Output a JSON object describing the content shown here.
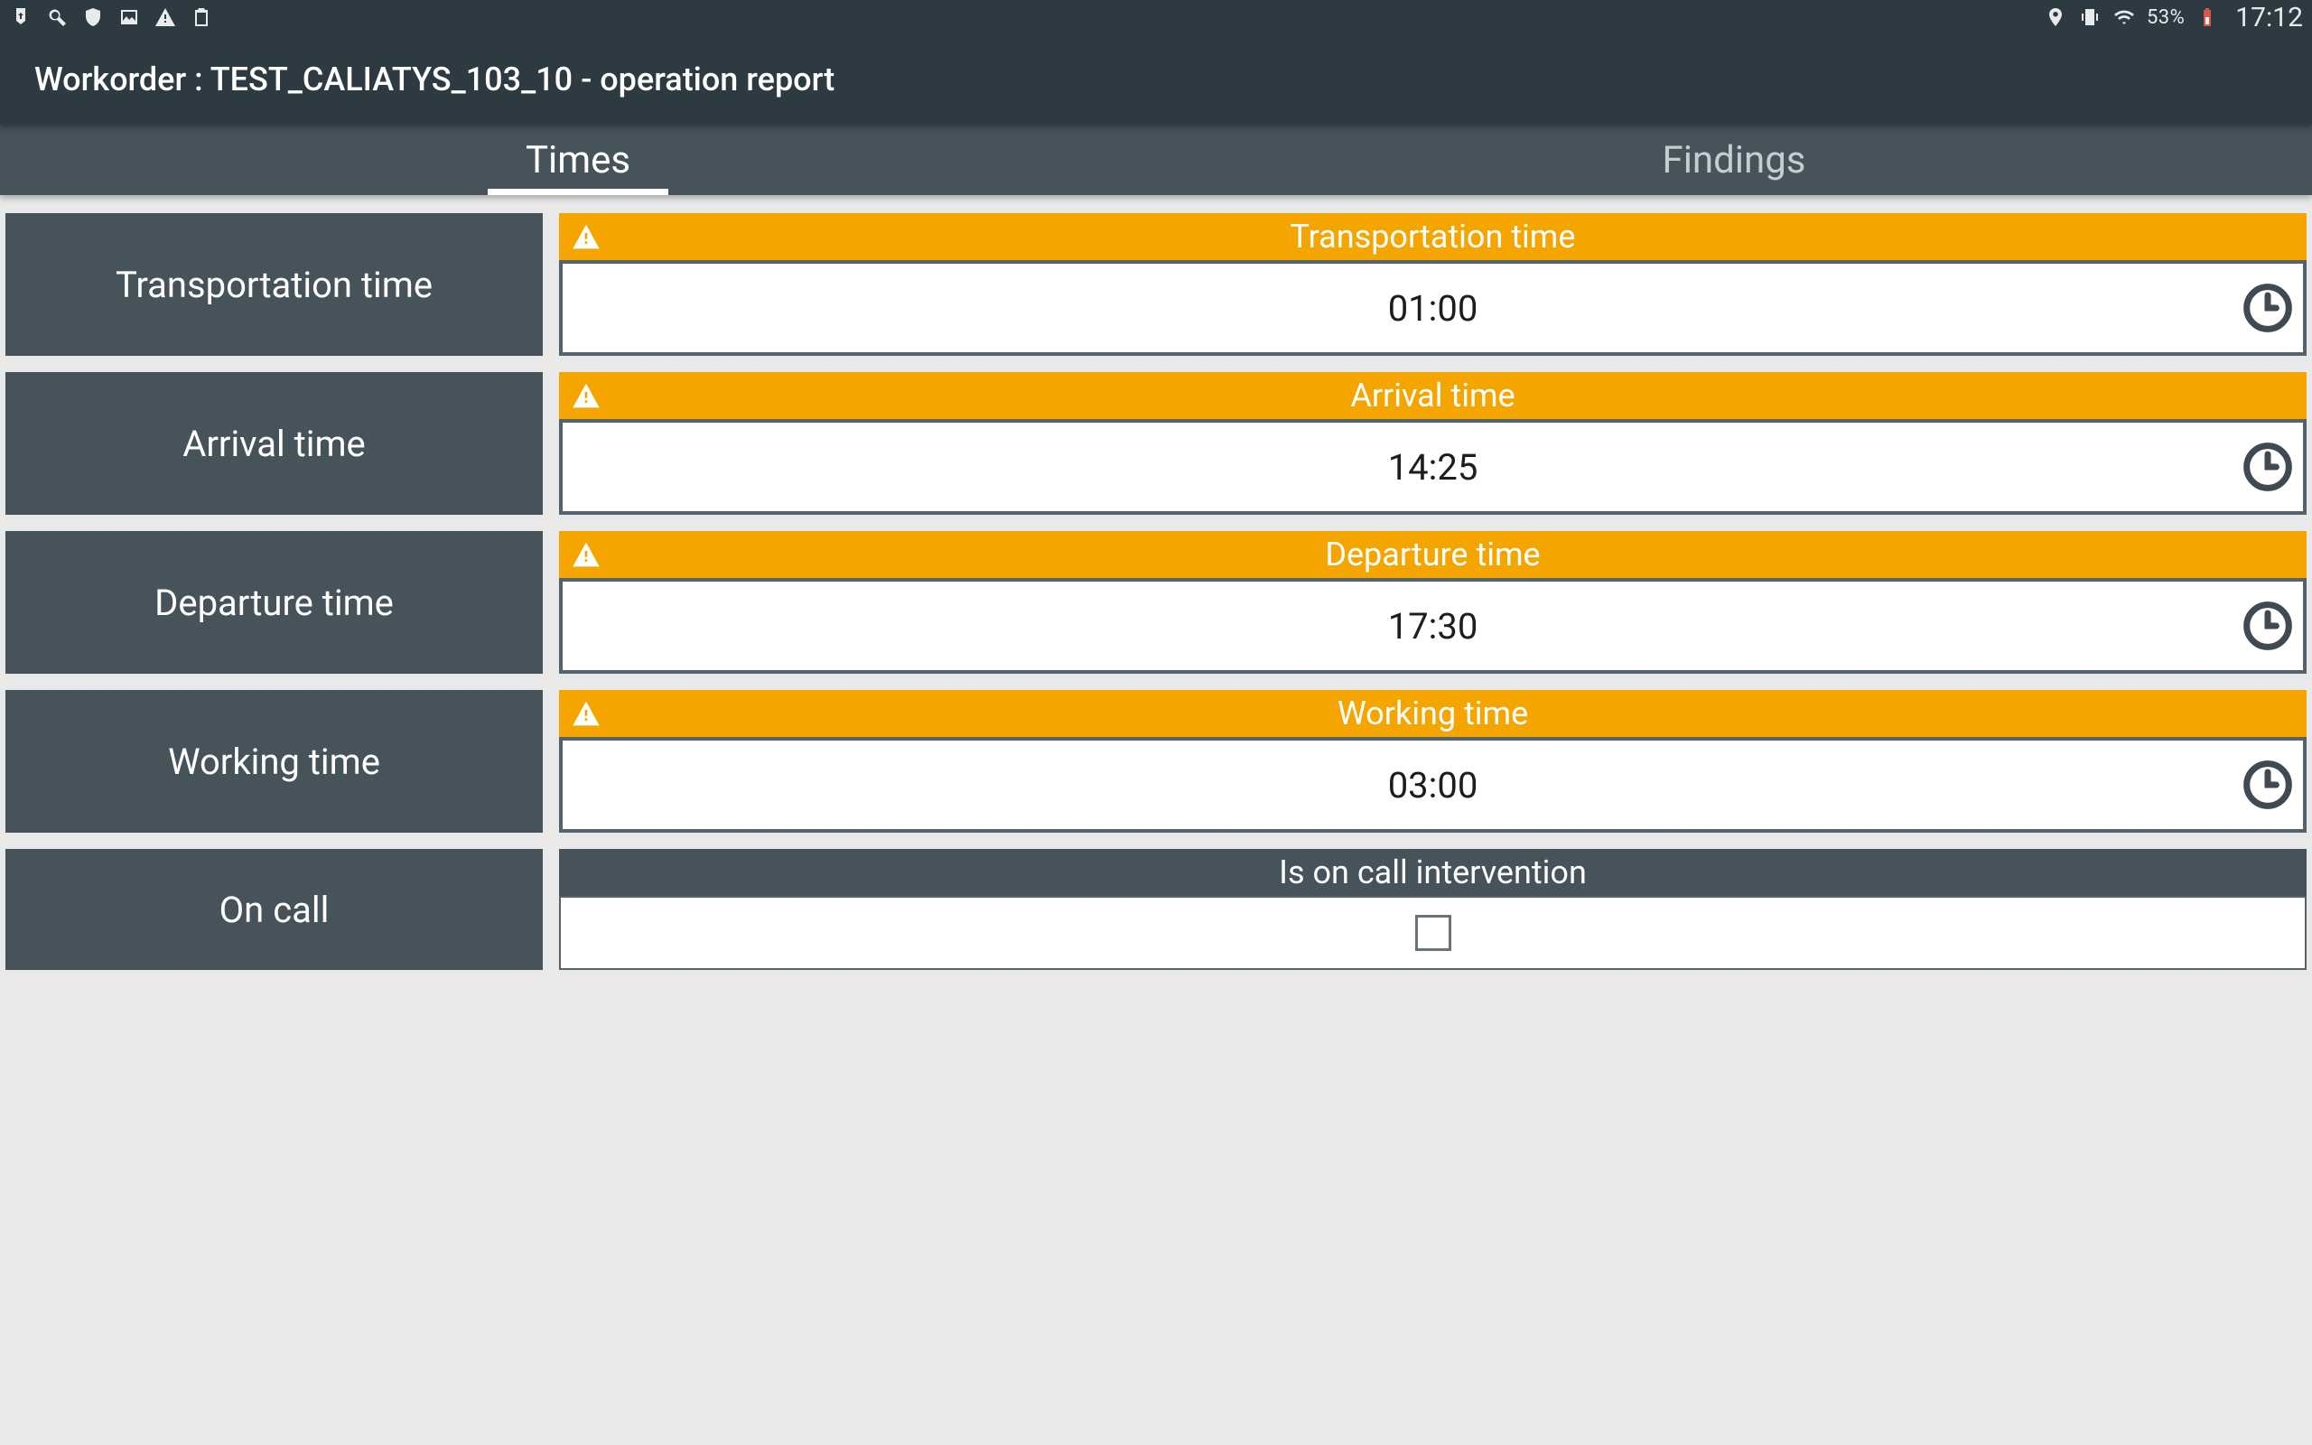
{
  "status": {
    "battery_pct": "53%",
    "time": "17:12"
  },
  "app": {
    "title": "Workorder : TEST_CALIATYS_103_10 - operation report"
  },
  "tabs": {
    "times": "Times",
    "findings": "Findings",
    "active": "times"
  },
  "rows": [
    {
      "key": "transportation",
      "label": "Transportation time",
      "header": "Transportation time",
      "value": "01:00",
      "warn": true,
      "has_clock": true
    },
    {
      "key": "arrival",
      "label": "Arrival time",
      "header": "Arrival time",
      "value": "14:25",
      "warn": true,
      "has_clock": true
    },
    {
      "key": "departure",
      "label": "Departure time",
      "header": "Departure time",
      "value": "17:30",
      "warn": true,
      "has_clock": true
    },
    {
      "key": "working",
      "label": "Working time",
      "header": "Working time",
      "value": "03:00",
      "warn": true,
      "has_clock": true
    }
  ],
  "oncall": {
    "label": "On call",
    "header": "Is on call intervention",
    "checked": false
  }
}
